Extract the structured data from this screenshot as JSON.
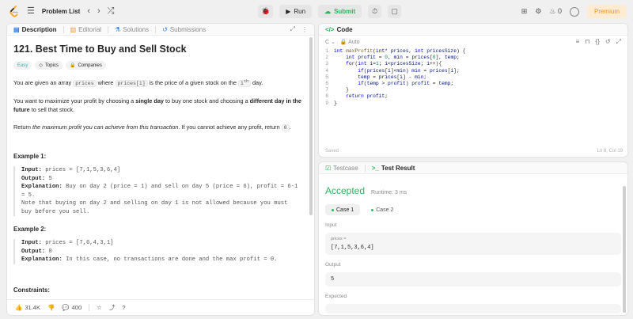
{
  "topbar": {
    "problem_list_label": "Problem List",
    "run_label": "Run",
    "submit_label": "Submit",
    "premium_label": "Premium",
    "streak_count": "0"
  },
  "description": {
    "tabs": [
      {
        "label": "Description"
      },
      {
        "label": "Editorial"
      },
      {
        "label": "Solutions"
      },
      {
        "label": "Submissions"
      }
    ],
    "title": "121. Best Time to Buy and Sell Stock",
    "difficulty": "Easy",
    "topics_label": "Topics",
    "companies_label": "Companies",
    "p1_a": "You are given an array ",
    "p1_code1": "prices",
    "p1_b": " where ",
    "p1_code2": "prices[i]",
    "p1_c": " is the price of a given stock on the ",
    "p1_i": "i",
    "p1_sup": "th",
    "p1_d": " day.",
    "p2_a": "You want to maximize your profit by choosing a ",
    "p2_b1": "single day",
    "p2_c": " to buy one stock and choosing a ",
    "p2_b2": "different day in the future",
    "p2_d": " to sell that stock.",
    "p3_a": "Return ",
    "p3_em": "the maximum profit you can achieve from this transaction",
    "p3_b": ". If you cannot achieve any profit, return ",
    "p3_code": "0",
    "p3_c": ".",
    "example1_title": "Example 1:",
    "example1_input_label": "Input:",
    "example1_input": " prices = [7,1,5,3,6,4]",
    "example1_output_label": "Output:",
    "example1_output": " 5",
    "example1_expl_label": "Explanation:",
    "example1_expl": " Buy on day 2 (price = 1) and sell on day 5 (price = 6), profit = 6-1\n= 5.\nNote that buying on day 2 and selling on day 1 is not allowed because you must\nbuy before you sell.",
    "example2_title": "Example 2:",
    "example2_input_label": "Input:",
    "example2_input": " prices = [7,6,4,3,1]",
    "example2_output_label": "Output:",
    "example2_output": " 0",
    "example2_expl_label": "Explanation:",
    "example2_expl": " In this case, no transactions are done and the max profit = 0.",
    "constraints_title": "Constraints:"
  },
  "footer": {
    "likes": "31.4K",
    "comments": "400"
  },
  "code": {
    "tab_label": "Code",
    "language": "C",
    "mode": "Auto",
    "status": "Saved",
    "cursor": "Ln 8, Col 19"
  },
  "result": {
    "tabs": [
      {
        "label": "Testcase"
      },
      {
        "label": "Test Result"
      }
    ],
    "status": "Accepted",
    "runtime": "Runtime: 3 ms",
    "case1": "Case 1",
    "case2": "Case 2",
    "input_label": "Input",
    "input_var": "prices =",
    "input_value": "[7,1,5,3,6,4]",
    "output_label": "Output",
    "output_value": "5",
    "expected_label": "Expected"
  }
}
